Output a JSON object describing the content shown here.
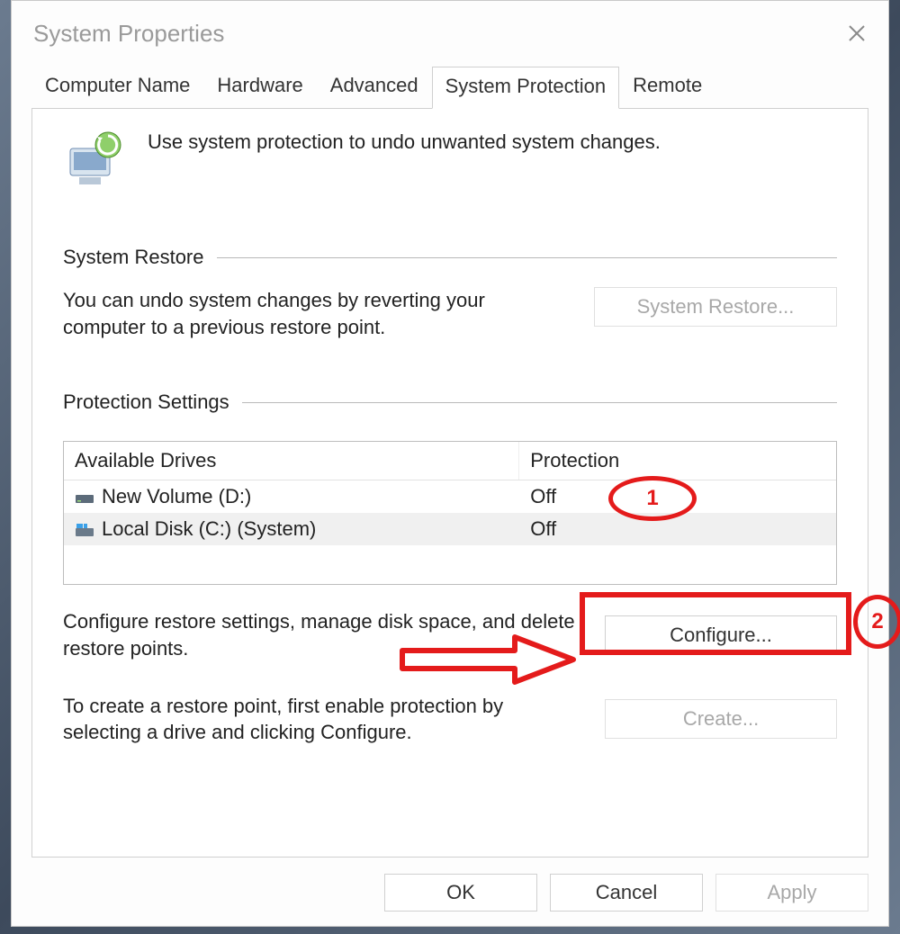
{
  "window": {
    "title": "System Properties"
  },
  "tabs": [
    {
      "label": "Computer Name"
    },
    {
      "label": "Hardware"
    },
    {
      "label": "Advanced"
    },
    {
      "label": "System Protection",
      "active": true
    },
    {
      "label": "Remote"
    }
  ],
  "intro": {
    "text": "Use system protection to undo unwanted system changes."
  },
  "restore_group": {
    "title": "System Restore",
    "description": "You can undo system changes by reverting your computer to a previous restore point.",
    "button": "System Restore..."
  },
  "protection_group": {
    "title": "Protection Settings",
    "table": {
      "col1": "Available Drives",
      "col2": "Protection",
      "rows": [
        {
          "icon": "drive",
          "name": "New Volume (D:)",
          "protection": "Off",
          "selected": false
        },
        {
          "icon": "sysdrive",
          "name": "Local Disk (C:) (System)",
          "protection": "Off",
          "selected": true
        }
      ]
    },
    "configure_text": "Configure restore settings, manage disk space, and delete restore points.",
    "configure_button": "Configure...",
    "create_text": "To create a restore point, first enable protection by selecting a drive and clicking Configure.",
    "create_button": "Create..."
  },
  "footer": {
    "ok": "OK",
    "cancel": "Cancel",
    "apply": "Apply"
  },
  "annotations": {
    "marker1": "1",
    "marker2": "2"
  }
}
